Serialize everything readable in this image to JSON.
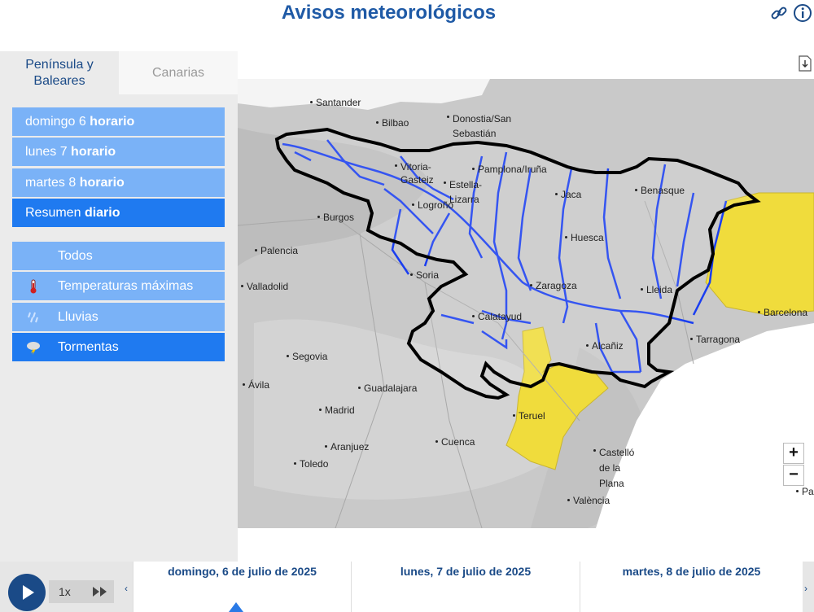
{
  "header": {
    "title": "Avisos meteorológicos",
    "link_icon": "link-icon",
    "info_icon": "info-icon"
  },
  "tabs": [
    {
      "label": "Península y Baleares",
      "active": true
    },
    {
      "label": "Canarias",
      "active": false
    }
  ],
  "days": [
    {
      "day": "domingo 6",
      "mode": "horario",
      "active": false
    },
    {
      "day": "lunes 7",
      "mode": "horario",
      "active": false
    },
    {
      "day": "martes 8",
      "mode": "horario",
      "active": false
    },
    {
      "day": "Resumen",
      "mode": "diario",
      "active": true
    }
  ],
  "filters": [
    {
      "label": "Todos",
      "icon": "",
      "active": false
    },
    {
      "label": "Temperaturas máximas",
      "icon": "thermometer-icon",
      "active": false
    },
    {
      "label": "Lluvias",
      "icon": "rain-icon",
      "active": false
    },
    {
      "label": "Tormentas",
      "icon": "storm-icon",
      "active": true
    }
  ],
  "map": {
    "cities": [
      "Santander",
      "Bilbao",
      "Donostia/San Sebastián",
      "Vitoria-Gasteiz",
      "Pamplona/Iruña",
      "Estella-Lizarra",
      "Logroño",
      "Jaca",
      "Benasque",
      "Burgos",
      "Huesca",
      "Palencia",
      "Soria",
      "Valladolid",
      "Zaragoza",
      "Lleida",
      "Barcelona",
      "Calatayud",
      "Tarragona",
      "Alcañiz",
      "Segovia",
      "Ávila",
      "Guadalajara",
      "Madrid",
      "Teruel",
      "Aranjuez",
      "Cuenca",
      "Toledo",
      "Castelló de la Plana",
      "València",
      "Pa"
    ],
    "zoom_in": "+",
    "zoom_out": "−",
    "logo": "aemet",
    "colors": {
      "warning_yellow": "#f0dc3c",
      "river_blue": "#1a3ef0",
      "border_black": "#000000"
    }
  },
  "timeline": {
    "speed": "1x",
    "days": [
      "domingo, 6 de julio de 2025",
      "lunes, 7 de julio de 2025",
      "martes, 8 de julio de 2025"
    ],
    "prev_arrow": "‹",
    "next_arrow": "›"
  }
}
